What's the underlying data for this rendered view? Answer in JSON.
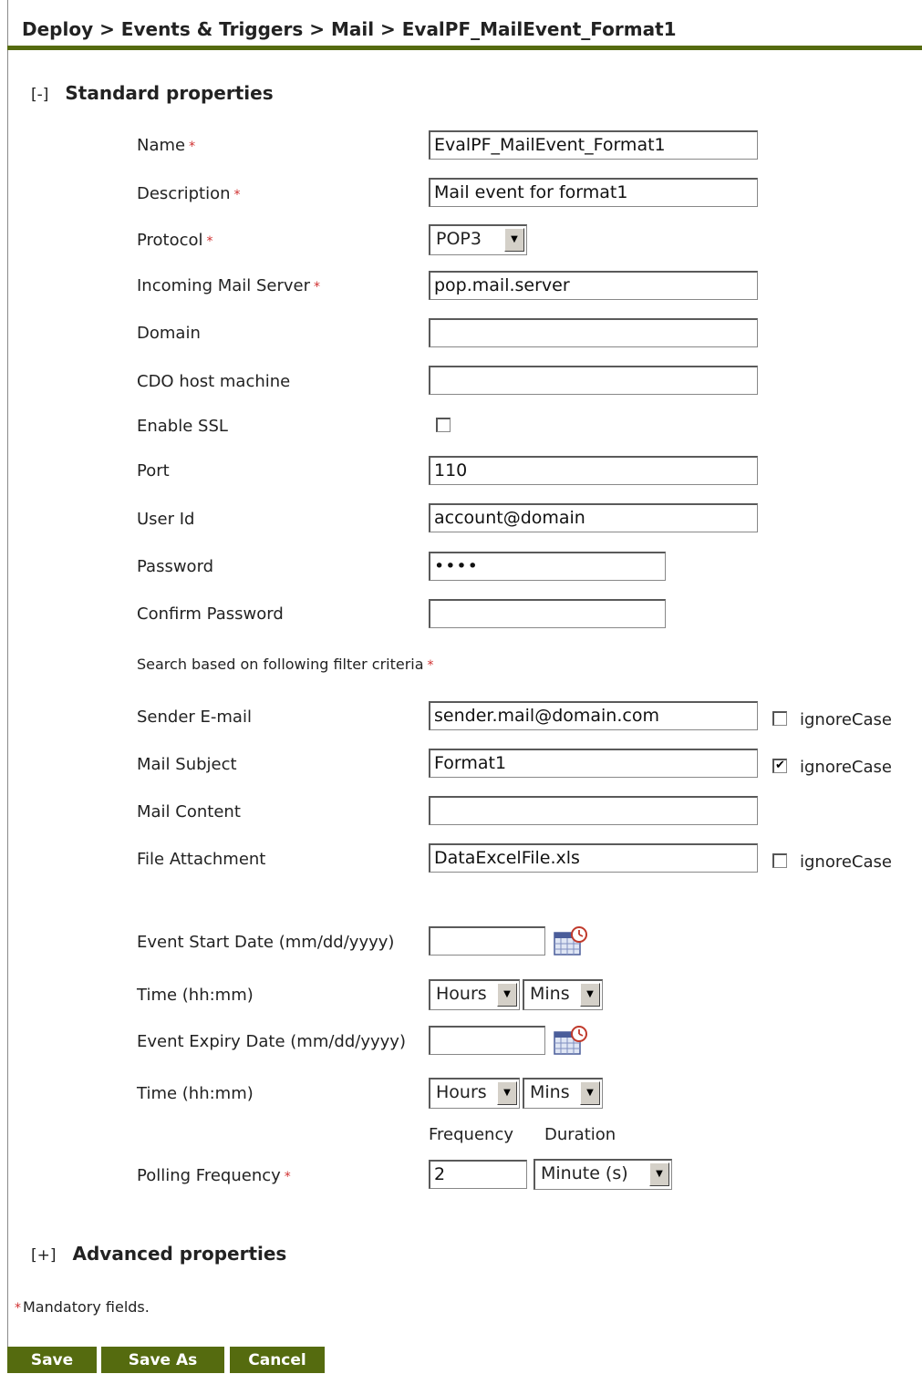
{
  "breadcrumb": "Deploy > Events & Triggers > Mail > EvalPF_MailEvent_Format1",
  "standard": {
    "toggle": "[-]",
    "title": "Standard properties"
  },
  "advanced": {
    "toggle": "[+]",
    "title": "Advanced properties"
  },
  "required_marker": "*",
  "fields": {
    "name": {
      "label": "Name",
      "value": "EvalPF_MailEvent_Format1"
    },
    "description": {
      "label": "Description",
      "value": "Mail event for format1"
    },
    "protocol": {
      "label": "Protocol",
      "value": "POP3"
    },
    "incoming_server": {
      "label": "Incoming Mail Server",
      "value": "pop.mail.server"
    },
    "domain": {
      "label": "Domain",
      "value": ""
    },
    "cdo_host": {
      "label": "CDO host machine",
      "value": ""
    },
    "enable_ssl": {
      "label": "Enable SSL",
      "checked": false
    },
    "port": {
      "label": "Port",
      "value": "110"
    },
    "user_id": {
      "label": "User Id",
      "value": "account@domain"
    },
    "password": {
      "label": "Password",
      "value": "••••"
    },
    "confirm_password": {
      "label": "Confirm Password",
      "value": ""
    }
  },
  "filter": {
    "heading": "Search based on following filter criteria",
    "ignore_case_label": "ignoreCase",
    "sender": {
      "label": "Sender E-mail",
      "value": "sender.mail@domain.com",
      "ignore_case": false
    },
    "subject": {
      "label": "Mail Subject",
      "value": "Format1",
      "ignore_case": true
    },
    "content": {
      "label": "Mail Content",
      "value": ""
    },
    "attachment": {
      "label": "File Attachment",
      "value": "DataExcelFile.xls",
      "ignore_case": false
    }
  },
  "schedule": {
    "start_date_label": "Event Start Date  (mm/dd/yyyy)",
    "start_date_value": "",
    "time_label": "Time  (hh:mm)",
    "hours": "Hours",
    "mins": "Mins",
    "expiry_date_label": "Event Expiry Date  (mm/dd/yyyy)",
    "expiry_date_value": ""
  },
  "polling": {
    "frequency_header": "Frequency",
    "duration_header": "Duration",
    "label": "Polling Frequency",
    "frequency_value": "2",
    "duration_value": "Minute (s)"
  },
  "mandatory_note": "Mandatory fields.",
  "buttons": {
    "save": "Save",
    "save_as": "Save As",
    "cancel": "Cancel"
  },
  "colors": {
    "accent": "#556b0f",
    "required": "#d03030"
  }
}
